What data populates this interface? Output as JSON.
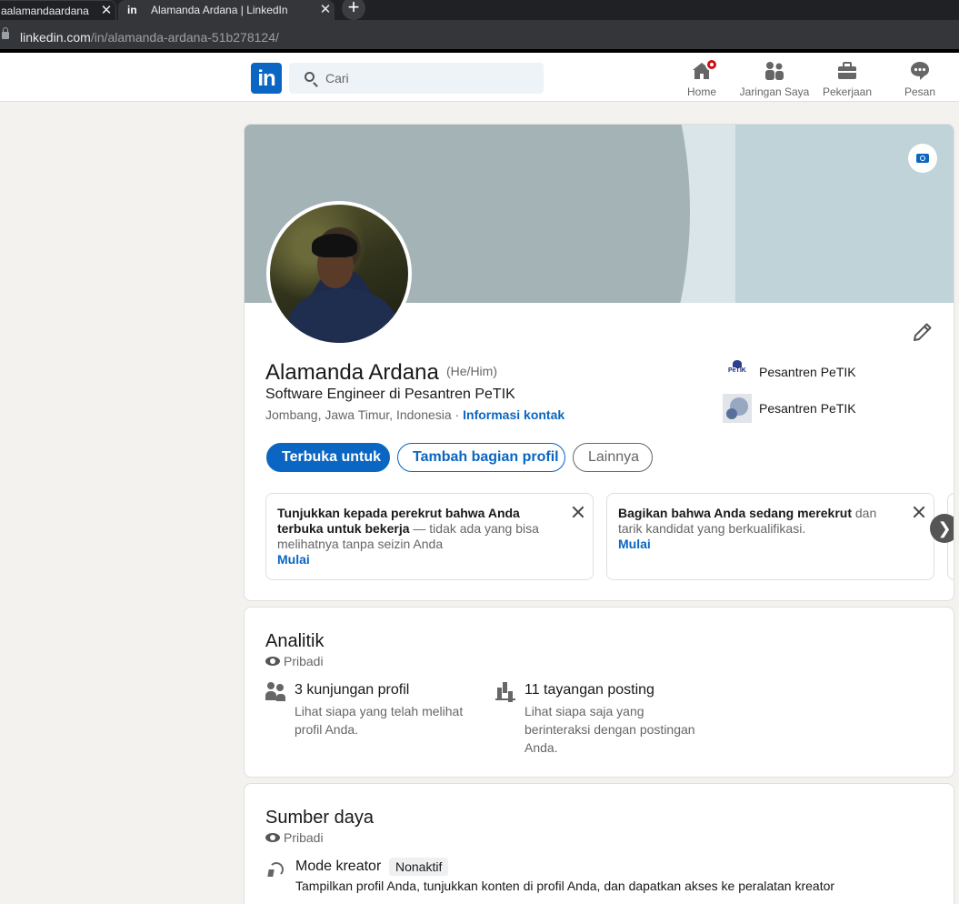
{
  "browser": {
    "tabs": [
      {
        "title": "aalamandaardana",
        "active": false
      },
      {
        "title": "Alamanda Ardana | LinkedIn",
        "active": true
      }
    ],
    "tab_close_glyph": "✕",
    "new_tab_glyph": "+",
    "tab_favicon": "in",
    "url_host": "linkedin.com",
    "url_path": "/in/alamanda-ardana-51b278124/"
  },
  "nav": {
    "logo_text": "in",
    "search_placeholder": "Cari",
    "items": [
      {
        "label": "Home",
        "icon": "home-icon",
        "badge": true
      },
      {
        "label": "Jaringan Saya",
        "icon": "network-icon"
      },
      {
        "label": "Pekerjaan",
        "icon": "briefcase-icon"
      },
      {
        "label": "Pesan",
        "icon": "messaging-icon"
      }
    ]
  },
  "profile": {
    "name": "Alamanda Ardana",
    "pronouns": "(He/Him)",
    "headline": "Software Engineer di Pesantren PeTIK",
    "location": "Jombang, Jawa Timur, Indonesia",
    "location_sep": " · ",
    "contact_link": "Informasi kontak",
    "orgs": [
      {
        "name": "Pesantren PeTIK"
      },
      {
        "name": "Pesantren PeTIK"
      }
    ],
    "buttons": {
      "open_to": "Terbuka untuk",
      "add_section": "Tambah bagian profil",
      "more": "Lainnya"
    },
    "notices": [
      {
        "bold": "Tunjukkan kepada perekrut bahwa Anda terbuka untuk bekerja",
        "rest": " — tidak ada yang bisa melihatnya tanpa seizin Anda",
        "link": "Mulai"
      },
      {
        "bold": "Bagikan bahwa Anda sedang merekrut",
        "rest": " dan tarik kandidat yang berkualifikasi.",
        "link": "Mulai"
      }
    ],
    "next_glyph": "❯"
  },
  "analytics": {
    "title": "Analitik",
    "visibility": "Pribadi",
    "stats": [
      {
        "title": "3 kunjungan profil",
        "desc": "Lihat siapa yang telah melihat profil Anda."
      },
      {
        "title": "11 tayangan posting",
        "desc": "Lihat siapa saja yang berinteraksi dengan postingan Anda."
      }
    ]
  },
  "resources": {
    "title": "Sumber daya",
    "visibility": "Pribadi",
    "creator_title": "Mode kreator",
    "creator_status": "Nonaktif",
    "creator_desc": "Tampilkan profil Anda, tunjukkan konten di profil Anda, dan dapatkan akses ke peralatan kreator"
  },
  "colors": {
    "brand": "#0a66c2",
    "notification": "#cc1016",
    "page_bg": "#f3f2ef"
  }
}
